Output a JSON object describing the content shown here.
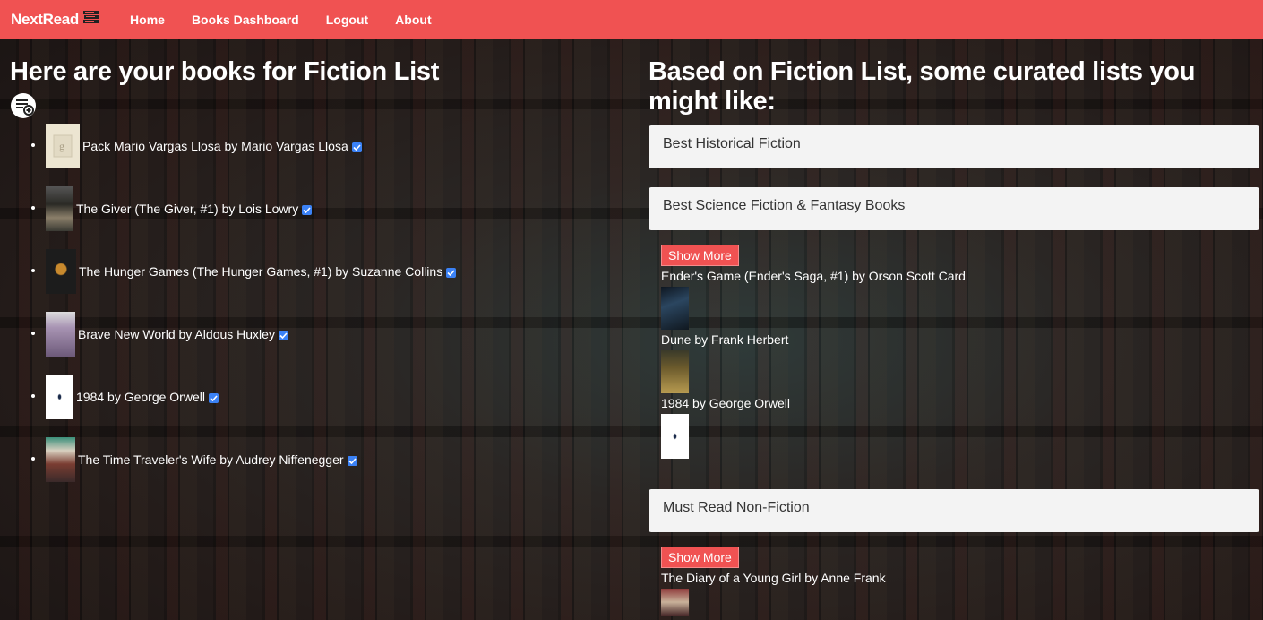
{
  "navbar": {
    "brand": "NextRead",
    "brand_icon": "book-stack-icon",
    "links": [
      "Home",
      "Books Dashboard",
      "Logout",
      "About"
    ]
  },
  "left": {
    "heading": "Here are your books for Fiction List",
    "add_icon": "add-playlist-icon",
    "books": [
      {
        "title": "Pack Mario Vargas Llosa by Mario Vargas Llosa",
        "cover_color": "#ece5d1"
      },
      {
        "title": "The Giver (The Giver, #1) by Lois Lowry",
        "cover_color": "#3b3a33"
      },
      {
        "title": "The Hunger Games (The Hunger Games, #1) by Suzanne Collins",
        "cover_color": "#1c1c1c"
      },
      {
        "title": "Brave New World by Aldous Huxley",
        "cover_color": "#b8a6c2"
      },
      {
        "title": "1984 by George Orwell",
        "cover_color": "#ffffff"
      },
      {
        "title": "The Time Traveler's Wife by Audrey Niffenegger",
        "cover_color": "#7a3d32"
      }
    ]
  },
  "right": {
    "heading": "Based on Fiction List, some curated lists you might like:",
    "lists": [
      {
        "title": "Best Historical Fiction",
        "show_more": "",
        "books": []
      },
      {
        "title": "Best Science Fiction & Fantasy Books",
        "show_more": "Show More",
        "books": [
          {
            "title": "Ender's Game (Ender's Saga, #1) by Orson Scott Card",
            "cover_color": "#1d2b3a"
          },
          {
            "title": "Dune by Frank Herbert",
            "cover_color": "#6b5a2c"
          },
          {
            "title": "1984 by George Orwell",
            "cover_color": "#ffffff"
          }
        ]
      },
      {
        "title": "Must Read Non-Fiction",
        "show_more": "Show More",
        "books": [
          {
            "title": "The Diary of a Young Girl by Anne Frank",
            "cover_color": "#8e3b3b"
          }
        ]
      }
    ]
  },
  "colors": {
    "accent": "#f05252",
    "verified": "#3b82f6"
  }
}
